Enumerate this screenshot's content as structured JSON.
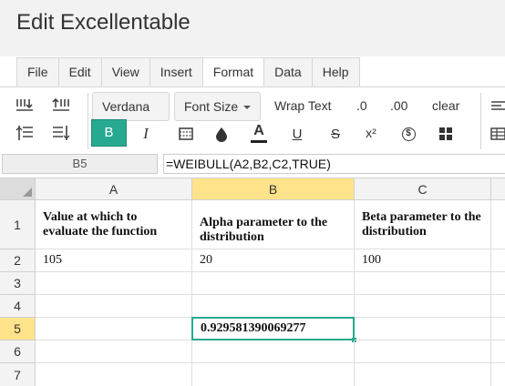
{
  "app": {
    "title": "Edit Excellentable"
  },
  "menu": {
    "items": [
      "File",
      "Edit",
      "View",
      "Insert",
      "Format",
      "Data",
      "Help"
    ],
    "active": "Format"
  },
  "toolbar": {
    "font_family": "Verdana",
    "font_size": "Font Size",
    "wrap_text": "Wrap Text",
    "decrease_decimal": ".0",
    "increase_decimal": ".00",
    "clear": "clear",
    "bold": "B",
    "italic": "I",
    "text_color": "A",
    "underline": "U",
    "strike": "S",
    "superscript": "x²",
    "currency": "$",
    "accent_color": "#26a990",
    "selected_header_color": "#ffe38a"
  },
  "formula_bar": {
    "cell_ref": "B5",
    "formula": "=WEIBULL(A2,B2,C2,TRUE)"
  },
  "sheet": {
    "columns": [
      "A",
      "B",
      "C"
    ],
    "rows": [
      "1",
      "2",
      "3",
      "4",
      "5",
      "6",
      "7"
    ],
    "selected_cell": "B5",
    "cells": {
      "A1": "Value at which to evaluate the function",
      "B1": "Alpha parameter to the distribution",
      "C1": "Beta parameter to the distribution",
      "A2": "105",
      "B2": "20",
      "C2": "100",
      "B5": "0.929581390069277"
    }
  }
}
